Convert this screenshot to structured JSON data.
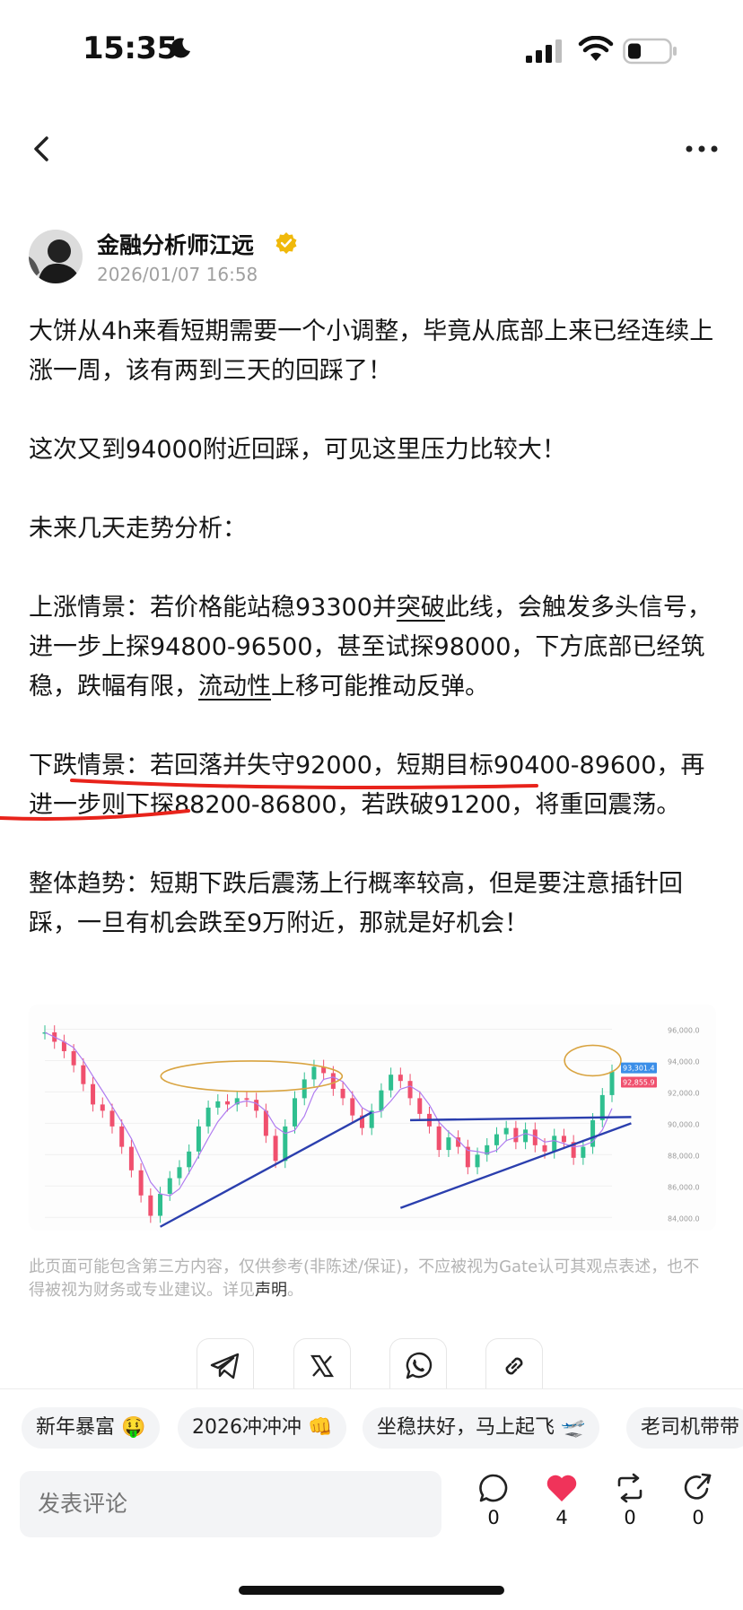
{
  "status_bar": {
    "time": "15:35",
    "icons": [
      "moon-icon",
      "signal-icon",
      "wifi-icon",
      "battery-icon"
    ]
  },
  "nav": {
    "back_icon": "chevron-left-icon",
    "more_icon": "more-horizontal-icon"
  },
  "author": {
    "name": "金融分析师江远",
    "verified_icon": "verified-badge-icon",
    "timestamp": "2026/01/07 16:58"
  },
  "post": {
    "p1": "大饼从4h来看短期需要一个小调整，毕竟从底部上来已经连续上涨一周，该有两到三天的回踩了！",
    "p2": "这次又到94000附近回踩，可见这里压力比较大！",
    "p3": "未来几天走势分析：",
    "p4_a": "上涨情景：若价格能站稳93300并",
    "p4_b": "突破",
    "p4_c": "此线，会触发多头信号，进一步上探94800-96500，甚至试探98000，下方底部已经筑稳，跌幅有限，",
    "p4_d": "流动性",
    "p4_e": "上移可能推动反弹。",
    "p5": "下跌情景：若回落并失守92000，短期目标90400-89600，再进一步则下探88200-86800，若跌破91200，将重回震荡。",
    "p6": "整体趋势：短期下跌后震荡上行概率较高，但是要注意插针回踩，一旦有机会跌至9万附近，那就是好机会！"
  },
  "chart_data": {
    "type": "line",
    "title": "",
    "y_tick_labels": [
      "96,000.0",
      "94,000.0",
      "92,000.0",
      "90,000.0",
      "88,000.0",
      "86,000.0",
      "84,000.0"
    ],
    "price_labels": [
      "93,301.4",
      "92,855.9"
    ],
    "ylim": [
      83500,
      97000
    ],
    "x": [
      0,
      1,
      2,
      3,
      4,
      5,
      6,
      7,
      8,
      9,
      10,
      11,
      12,
      13,
      14,
      15,
      16,
      17,
      18,
      19,
      20,
      21,
      22,
      23,
      24,
      25,
      26,
      27,
      28,
      29,
      30,
      31,
      32,
      33,
      34,
      35,
      36,
      37,
      38,
      39,
      40,
      41,
      42,
      43,
      44,
      45,
      46,
      47,
      48,
      49,
      50,
      51,
      52,
      53,
      54,
      55,
      56,
      57,
      58,
      59
    ],
    "series": [
      {
        "values": [
          95800,
          95200,
          94600,
          93700,
          92500,
          91200,
          90800,
          89800,
          88500,
          87000,
          85400,
          84100,
          85500,
          86500,
          87200,
          88200,
          89800,
          91000,
          91400,
          91200,
          91600,
          91500,
          90800,
          89200,
          87600,
          89800,
          91600,
          92800,
          93600,
          93200,
          92200,
          91600,
          90500,
          89700,
          90800,
          92100,
          93100,
          92700,
          91600,
          90600,
          89800,
          88300,
          89100,
          88500,
          87200,
          88000,
          88600,
          89300,
          89700,
          88800,
          89600,
          88600,
          88200,
          89200,
          88800,
          87800,
          88500,
          90200,
          91800,
          93300
        ]
      }
    ],
    "annotations": [
      "resistance-ellipse",
      "resistance-ellipse",
      "resistance-ellipse",
      "trendline",
      "trendline",
      "trendline"
    ],
    "grid": true
  },
  "disclaimer": {
    "text": "此页面可能包含第三方内容，仅供参考(非陈述/保证)，不应被视为Gate认可其观点表述，也不得被视为财务或专业建议。详见",
    "link": "声明",
    "end": "。"
  },
  "share": {
    "icons": [
      "telegram-icon",
      "x-icon",
      "whatsapp-icon",
      "link-icon"
    ]
  },
  "tags": [
    "新年暴富 🤑",
    "2026冲冲冲 👊",
    "坐稳扶好，马上起飞 🛫",
    "老司机带带"
  ],
  "comment": {
    "placeholder": "发表评论"
  },
  "actions": [
    {
      "icon": "comment-icon",
      "count": "0"
    },
    {
      "icon": "heart-icon",
      "count": "4"
    },
    {
      "icon": "repost-icon",
      "count": "0"
    },
    {
      "icon": "share-icon",
      "count": "0"
    }
  ]
}
